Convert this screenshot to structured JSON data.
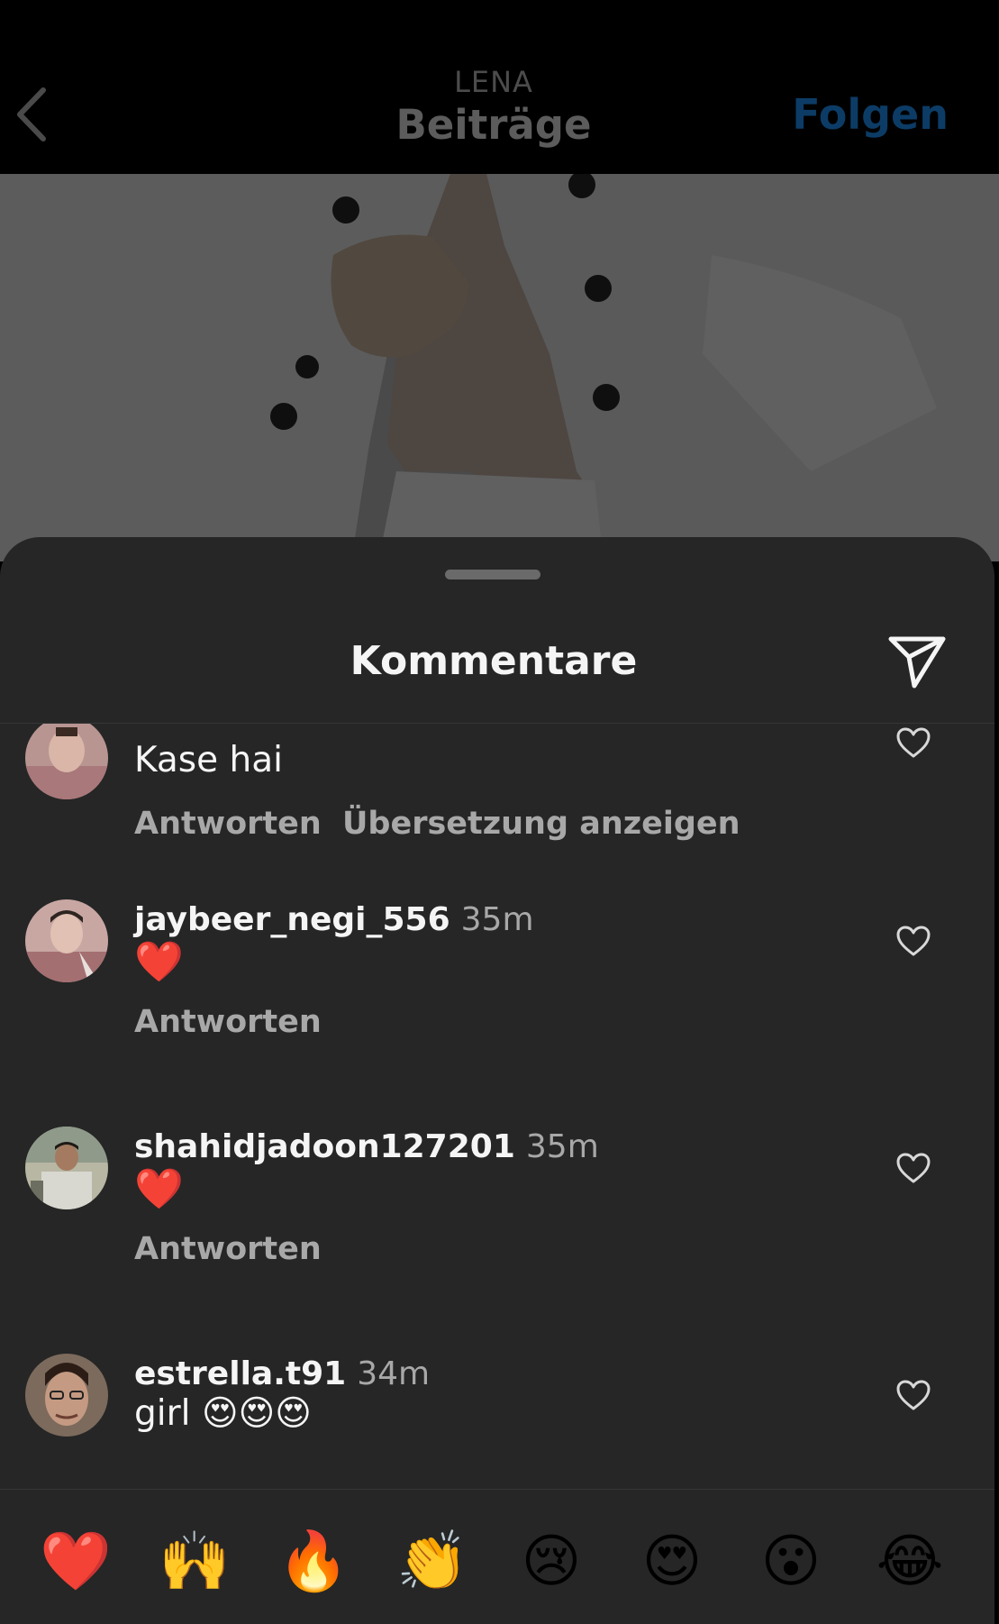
{
  "header": {
    "back_icon": "chevron-left-icon",
    "subtitle": "LENA",
    "title": "Beiträge",
    "follow_label": "Folgen"
  },
  "colors": {
    "sheet_background": "#262626",
    "primary_text": "#f5f5f5",
    "secondary_text": "#a8a8a8",
    "follow_dimmed": "#0c3c66",
    "heart_red": "#e8202a"
  },
  "sheet": {
    "title": "Kommentare",
    "share_icon": "paper-plane-icon"
  },
  "comments": [
    {
      "username": "",
      "time": "",
      "text": "Kase hai",
      "reply_label": "Antworten",
      "translate_label": "Übersetzung anzeigen",
      "like_icon": "heart-outline-icon"
    },
    {
      "username": "jaybeer_negi_556",
      "time": "35m",
      "text": "❤️",
      "reply_label": "Antworten",
      "like_icon": "heart-outline-icon"
    },
    {
      "username": "shahidjadoon127201",
      "time": "35m",
      "text": "❤️",
      "reply_label": "Antworten",
      "like_icon": "heart-outline-icon"
    },
    {
      "username": "estrella.t91",
      "time": "34m",
      "text": "girl 😍😍😍",
      "like_icon": "heart-outline-icon"
    }
  ],
  "emoji_bar": [
    "❤️",
    "🙌",
    "🔥",
    "👏",
    "😢",
    "😍",
    "😮",
    "😂"
  ]
}
